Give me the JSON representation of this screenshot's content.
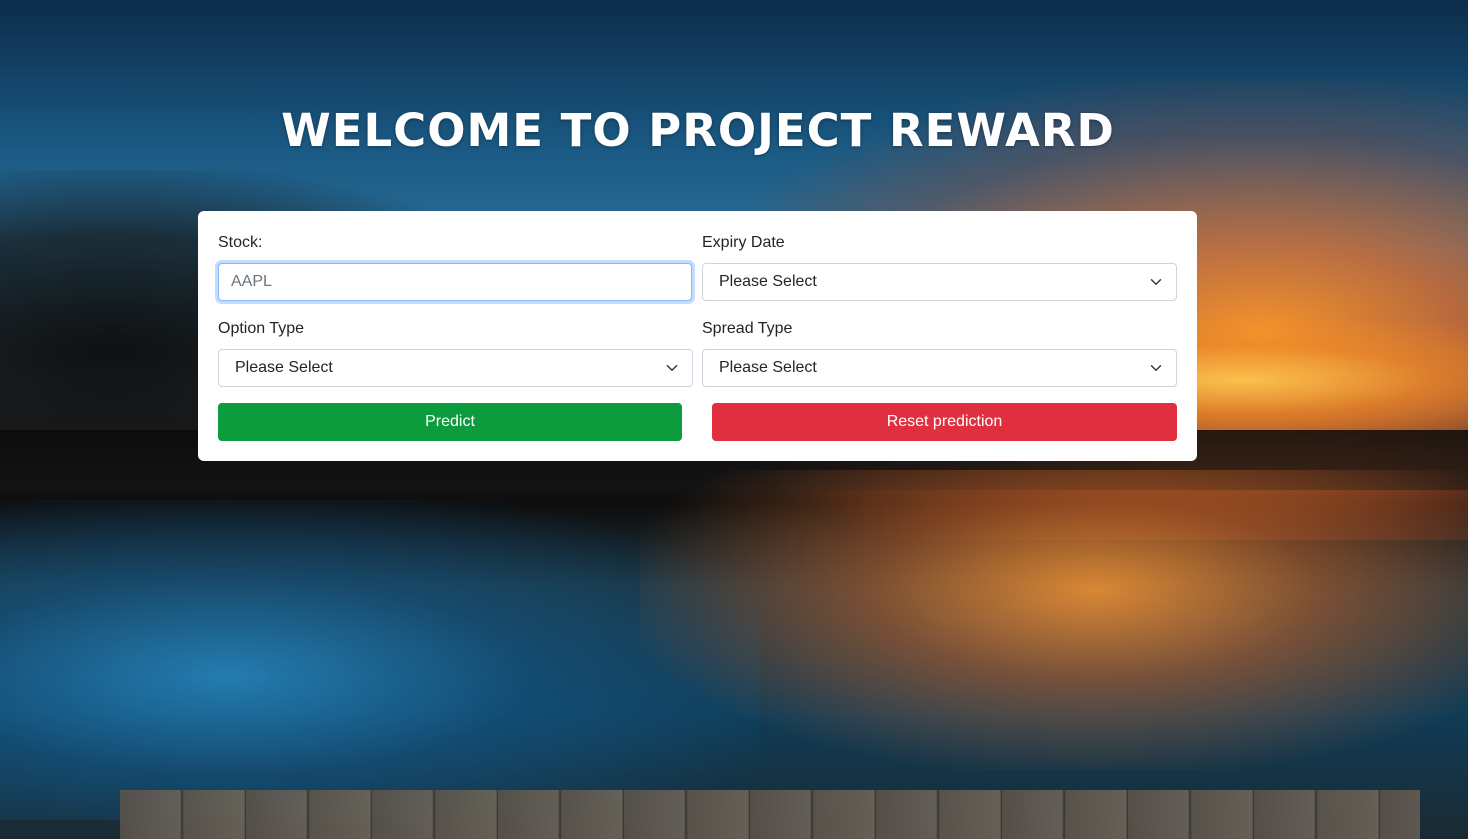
{
  "page": {
    "title": "WELCOME TO PROJECT REWARD"
  },
  "form": {
    "stock": {
      "label": "Stock:",
      "placeholder": "AAPL",
      "value": ""
    },
    "expiry_date": {
      "label": "Expiry Date",
      "selected": "Please Select"
    },
    "option_type": {
      "label": "Option Type",
      "selected": "Please Select"
    },
    "spread_type": {
      "label": "Spread Type",
      "selected": "Please Select"
    },
    "predict_label": "Predict",
    "reset_label": "Reset prediction"
  },
  "colors": {
    "predict_button": "#0c9b3d",
    "reset_button": "#e0303f",
    "card_background": "#ffffff",
    "title_text": "#ffffff"
  },
  "icons": {
    "select_indicator": "chevron-down-icon",
    "background": "lake-sunset-image"
  }
}
